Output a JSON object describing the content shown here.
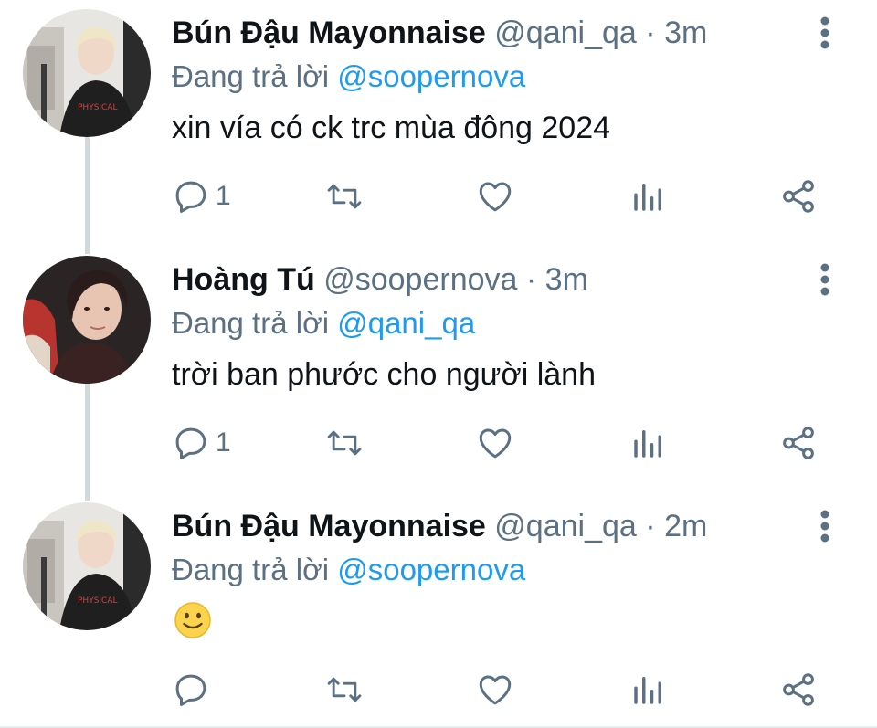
{
  "tweets": [
    {
      "name": "Bún Đậu Mayonnaise",
      "handle": "@qani_qa",
      "separator": "·",
      "time": "3m",
      "reply_prefix": "Đang trả lời",
      "reply_to": "@soopernova",
      "text": "xin vía có ck trc mùa đông 2024",
      "reply_count": "1"
    },
    {
      "name": "Hoàng Tú",
      "handle": "@soopernova",
      "separator": "·",
      "time": "3m",
      "reply_prefix": "Đang trả lời",
      "reply_to": "@qani_qa",
      "text": "trời ban phước cho người lành",
      "reply_count": "1"
    },
    {
      "name": "Bún Đậu Mayonnaise",
      "handle": "@qani_qa",
      "separator": "·",
      "time": "2m",
      "reply_prefix": "Đang trả lời",
      "reply_to": "@soopernova",
      "text": "",
      "reply_count": ""
    }
  ],
  "icons": {
    "reply": "reply-icon",
    "retweet": "retweet-icon",
    "like": "heart-icon",
    "views": "views-icon",
    "share": "share-icon",
    "more": "more-vertical-icon",
    "emoji": "slightly-smiling-face-emoji"
  },
  "colors": {
    "mention": "#1d9bf0",
    "secondary_text": "#5b7083",
    "primary_text": "#0f1419",
    "thread_line": "#cfd9de"
  }
}
